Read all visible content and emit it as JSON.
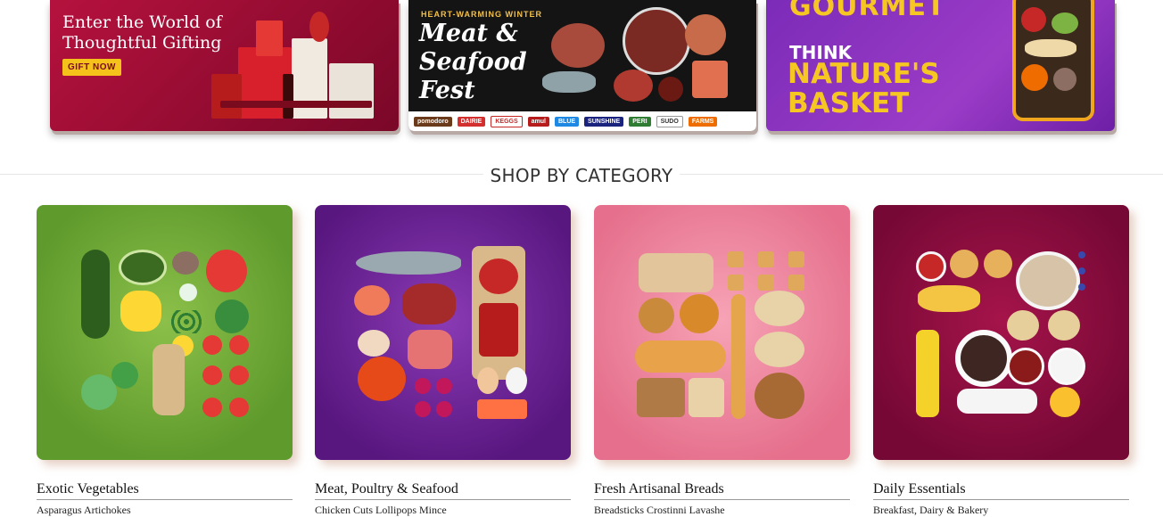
{
  "banners": [
    {
      "line1": "Enter the World of",
      "line2": "Thoughtful Gifting",
      "cta": "GIFT NOW",
      "accent": "#f5c21b"
    },
    {
      "kicker": "HEART-WARMING WINTER",
      "title": "Meat & Seafood Fest",
      "brands": [
        "pomodoro",
        "DAIRIE",
        "KEGGS",
        "amul",
        "BLUE",
        "SUNSHINE",
        "PERI",
        "SUDO",
        "FARMS"
      ]
    },
    {
      "top": "GOURMET",
      "think": "THINK",
      "line1": "NATURE'S",
      "line2": "BASKET",
      "accent": "#f6c622"
    }
  ],
  "section": {
    "title": "SHOP BY CATEGORY"
  },
  "categories": [
    {
      "title": "Exotic Vegetables",
      "sub": "Asparagus  Artichokes",
      "color": "#6fa936"
    },
    {
      "title": "Meat, Poultry & Seafood",
      "sub": "Chicken Cuts  Lollipops  Mince",
      "color": "#6b2396"
    },
    {
      "title": "Fresh Artisanal Breads",
      "sub": "Breadsticks  Crostinni  Lavashe",
      "color": "#ef8aa1"
    },
    {
      "title": "Daily Essentials",
      "sub": "Breakfast, Dairy & Bakery",
      "color": "#8e0c40"
    }
  ]
}
